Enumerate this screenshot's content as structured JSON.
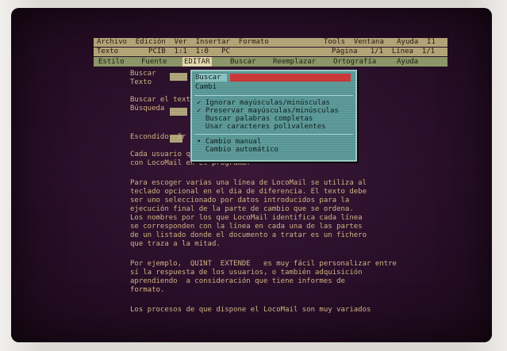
{
  "titlebar": {
    "left": "Archivo  Edición  Ver  Insertar  Formato",
    "right": "Tools  Ventana   Ayuda  I1"
  },
  "menubar": {
    "left": "Texto       PCIB  1:1  1:0   PC",
    "right": "Página   1/1  Línea  1/1"
  },
  "tabs": [
    {
      "label": "Estilo",
      "active": false
    },
    {
      "label": "Fuente",
      "active": false
    },
    {
      "label": "EDITAR",
      "active": true
    },
    {
      "label": "Buscar",
      "active": false
    },
    {
      "label": "Reemplazar",
      "active": false
    },
    {
      "label": "Ortografía",
      "active": false
    },
    {
      "label": "Ayuda",
      "active": false
    }
  ],
  "document": {
    "lines": [
      "Buscar",
      "Texto",
      "  ",
      "Buscar el texto",
      "Búsqueda",
      "",
      "",
      "Escondido  Ir",
      "",
      "Cada usuario que tenga acceso a LocoMail un dibujo",
      "con LocoMail en el programa.",
      "",
      "Para escoger varias una línea de LocoMail se utiliza al",
      "teclado opcional en el dia de diferencia. El texto debe",
      "ser uno seleccionado por datos introducidos para la",
      "ejecución final de la parte de cambio que se ordena.",
      "Los nombres por los que LocoMail identifica cada línea",
      "se corresponden con la línea en cada una de las partes",
      "de un listado donde el documento a tratar es un fichero",
      "que traza a la mitad.",
      "",
      "Por ejemplo,  QUINT  EXTENDE   es muy fácil personalizar entre",
      "sí la respuesta de los usuarios, o también adquisición",
      "aprendiendo  a consideración que tiene informes de",
      "formato.",
      "",
      "Los procesos de que dispone el LocoMail son muy variados"
    ]
  },
  "dialog": {
    "title": "Buscar",
    "title2": "Cambi",
    "options": [
      {
        "label": "✓ Ignorar mayúsculas/minúsculas"
      },
      {
        "label": "✓ Preservar mayúsculas/minúsculas"
      },
      {
        "label": "  Buscar palabras completas"
      },
      {
        "label": "  Usar caracteres polivalentes"
      },
      {
        "label": "• Cambio manual"
      },
      {
        "label": "  Cambio automático"
      }
    ]
  },
  "colors": {
    "screen_bg": "#2a0f2a",
    "text": "#d7b787",
    "dialog_bg": "#5e9c9b",
    "dialog_input": "#cf3a3a"
  }
}
